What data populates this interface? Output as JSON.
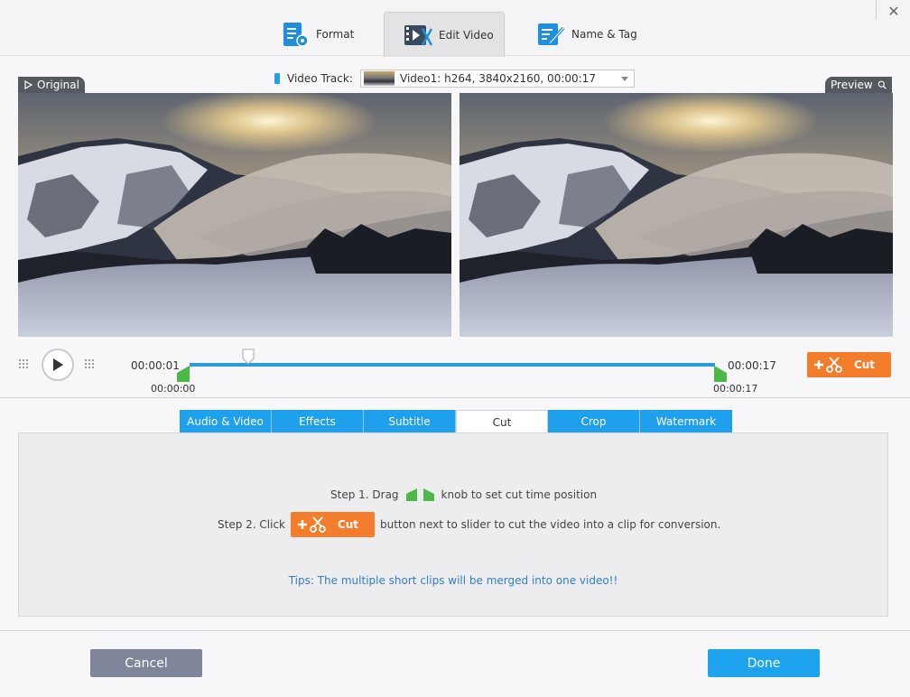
{
  "header": {
    "tabs": [
      {
        "label": "Format",
        "icon": "format-icon"
      },
      {
        "label": "Edit Video",
        "icon": "edit-video-icon",
        "active": true
      },
      {
        "label": "Name & Tag",
        "icon": "name-tag-icon"
      }
    ],
    "close_icon": "close-icon"
  },
  "video_track": {
    "label": "Video Track:",
    "selected": "Video1: h264, 3840x2160, 00:00:17"
  },
  "panes": {
    "original_label": "Original",
    "preview_label": "Preview"
  },
  "timeline": {
    "start_time_top": "00:00:01",
    "start_time_bottom": "00:00:00",
    "end_time_top": "00:00:17",
    "end_time_bottom": "00:00:17"
  },
  "cut_button": {
    "label": "Cut"
  },
  "edit_tabs": [
    {
      "label": "Audio & Video"
    },
    {
      "label": "Effects"
    },
    {
      "label": "Subtitle"
    },
    {
      "label": "Cut",
      "active": true
    },
    {
      "label": "Crop"
    },
    {
      "label": "Watermark"
    }
  ],
  "instructions": {
    "step1_prefix": "Step 1. Drag",
    "step1_suffix": "knob to set cut time position",
    "step2_prefix": "Step 2. Click",
    "step2_suffix": "button next to slider to cut the video into a clip for conversion.",
    "tips": "Tips: The multiple short clips will be merged into one video!!"
  },
  "footer": {
    "cancel": "Cancel",
    "done": "Done"
  },
  "colors": {
    "accent_blue": "#1ea0ec",
    "cut_orange": "#f47d2b",
    "knob_green": "#4cb848",
    "tips_blue": "#2f7fc9"
  }
}
